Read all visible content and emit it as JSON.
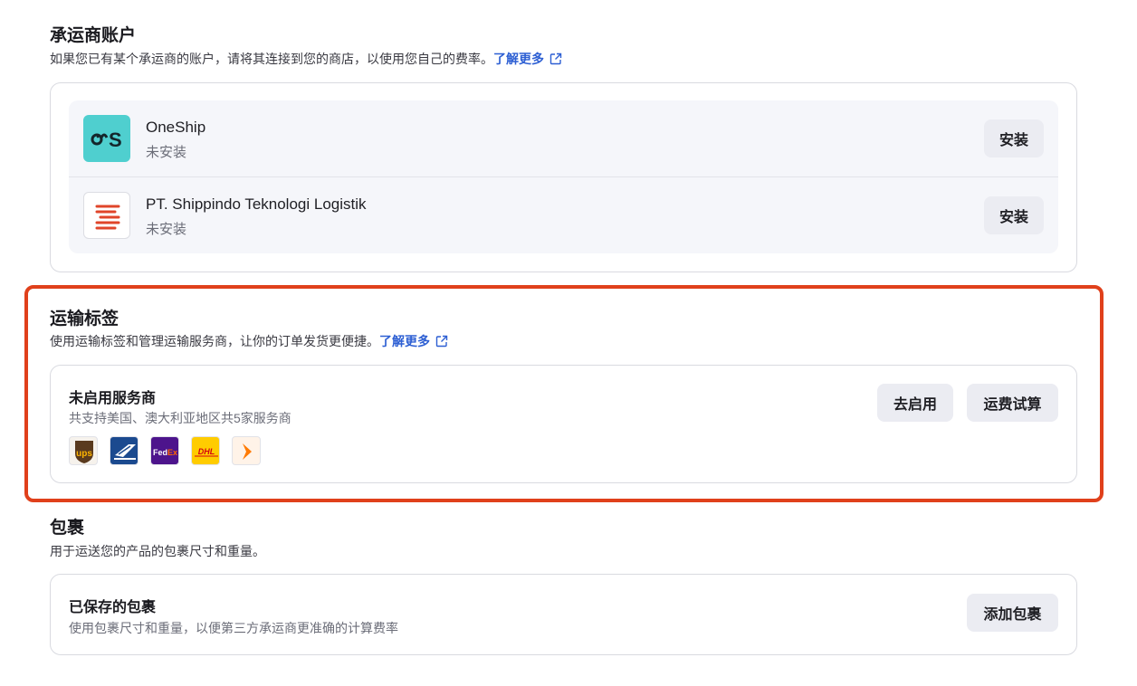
{
  "carrier_accounts": {
    "title": "承运商账户",
    "description": "如果您已有某个承运商的账户，请将其连接到您的商店，以使用您自己的费率。",
    "learn_more": "了解更多",
    "carriers": [
      {
        "name": "OneShip",
        "status": "未安装",
        "button": "安装",
        "logo_text": "ᴗS",
        "logo_bg": "#4fcfcf"
      },
      {
        "name": "PT. Shippindo Teknologi Logistik",
        "status": "未安装",
        "button": "安装",
        "logo_bg": "#ffffff",
        "logo_color": "#e0452a"
      }
    ]
  },
  "shipping_labels": {
    "title": "运输标签",
    "description": "使用运输标签和管理运输服务商，让你的订单发货更便捷。",
    "learn_more": "了解更多",
    "card": {
      "title": "未启用服务商",
      "subtitle": "共支持美国、澳大利亚地区共5家服务商",
      "enable_button": "去启用",
      "calc_button": "运费试算",
      "services": [
        {
          "icon": "ups-logo",
          "text": "ups",
          "bg": "#5a3a1e",
          "fg": "#ffb500"
        },
        {
          "icon": "usps-logo",
          "bg": "#1b4a8f"
        },
        {
          "icon": "fedex-logo",
          "text_a": "Fed",
          "text_b": "Ex",
          "bg": "#4d148c",
          "fg_b": "#ff6600"
        },
        {
          "icon": "dhl-logo",
          "text": "DHL",
          "bg": "#ffcc00",
          "fg": "#d40511"
        },
        {
          "icon": "sendle-logo",
          "bg": "#fff3e8",
          "fg": "#ff7a00"
        }
      ]
    }
  },
  "packages": {
    "title": "包裹",
    "description": "用于运送您的产品的包裹尺寸和重量。",
    "card": {
      "title": "已保存的包裹",
      "subtitle": "使用包裹尺寸和重量，以便第三方承运商更准确的计算费率",
      "add_button": "添加包裹"
    }
  },
  "colors": {
    "accent": "#2d5fd3",
    "highlight": "#e0401b",
    "button_bg": "#ebecf2"
  }
}
